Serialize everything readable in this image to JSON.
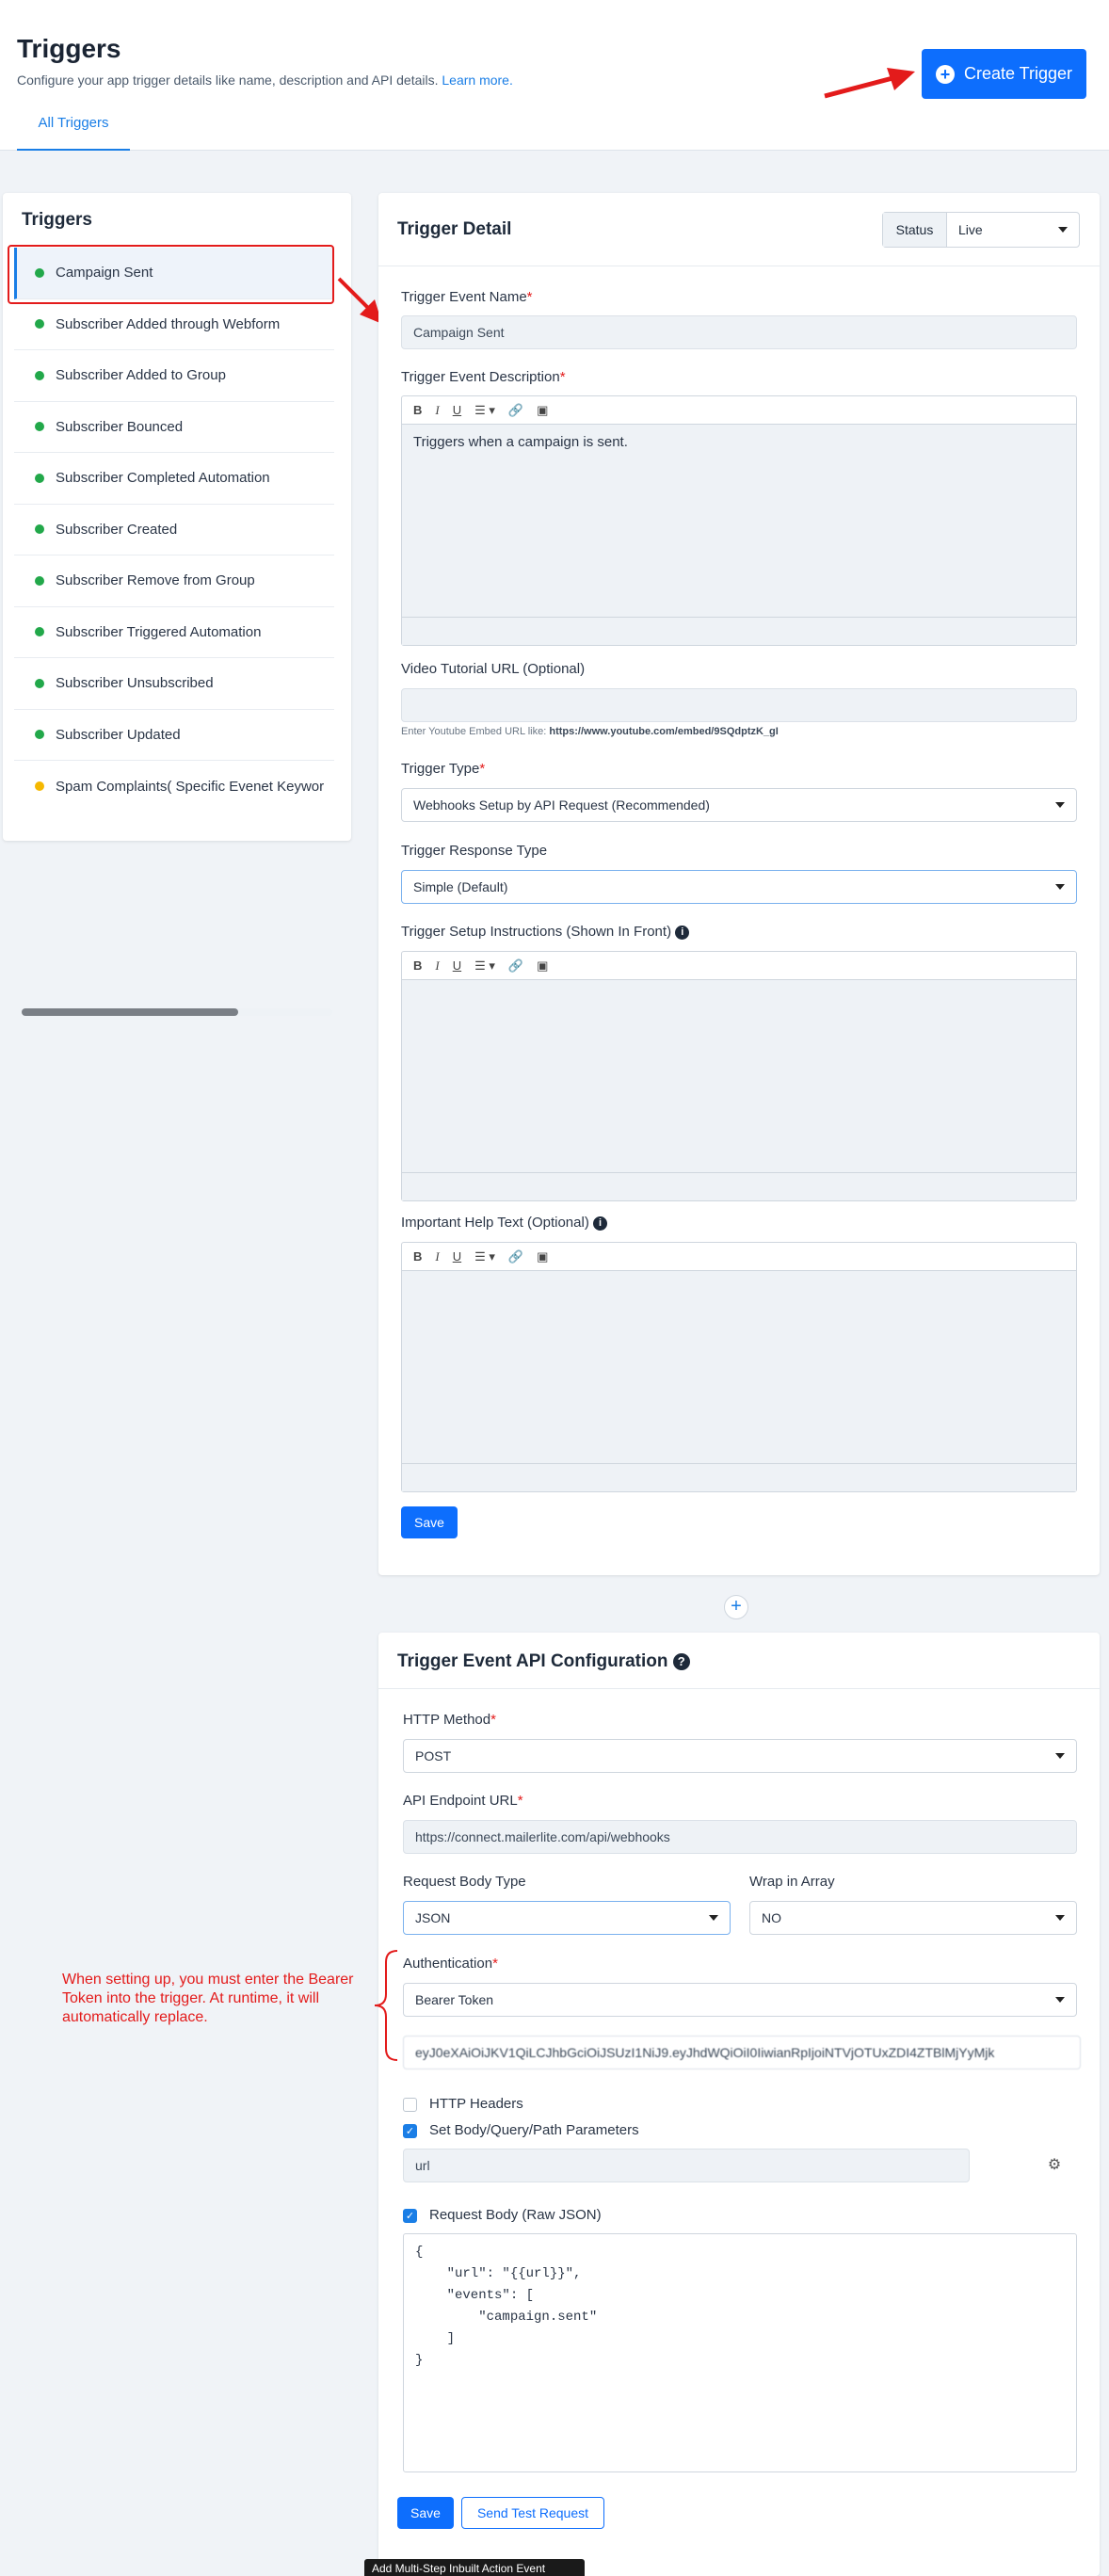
{
  "header": {
    "title": "Triggers",
    "subtitle": "Configure your app trigger details like name, description and API details.",
    "learn_more": "Learn more.",
    "tab": "All Triggers",
    "create_button": "Create Trigger"
  },
  "sidebar": {
    "title": "Triggers",
    "items": [
      {
        "label": "Campaign Sent"
      },
      {
        "label": "Subscriber Added through Webform"
      },
      {
        "label": "Subscriber Added to Group"
      },
      {
        "label": "Subscriber Bounced"
      },
      {
        "label": "Subscriber Completed Automation"
      },
      {
        "label": "Subscriber Created"
      },
      {
        "label": "Subscriber Remove from Group"
      },
      {
        "label": "Subscriber Triggered Automation"
      },
      {
        "label": "Subscriber Unsubscribed"
      },
      {
        "label": "Subscriber Updated"
      },
      {
        "label": "Spam Complaints( Specific Evenet Keywor"
      }
    ]
  },
  "detail": {
    "title": "Trigger Detail",
    "status_label": "Status",
    "status_value": "Live",
    "event_name_label": "Trigger Event Name",
    "event_name_value": "Campaign Sent",
    "description_label": "Trigger Event Description",
    "description_value": "Triggers when a campaign is sent.",
    "video_label": "Video Tutorial URL (Optional)",
    "video_hint": "Enter Youtube Embed URL like:",
    "video_hint_url": "https://www.youtube.com/embed/9SQdptzK_gI",
    "type_label": "Trigger Type",
    "type_value": "Webhooks Setup by API Request (Recommended)",
    "response_label": "Trigger Response Type",
    "response_value": "Simple (Default)",
    "instructions_label": "Trigger Setup Instructions (Shown In Front)",
    "help_label": "Important Help Text (Optional)",
    "save": "Save"
  },
  "api": {
    "title": "Trigger Event API Configuration",
    "method_label": "HTTP Method",
    "method_value": "POST",
    "endpoint_label": "API Endpoint URL",
    "endpoint_value": "https://connect.mailerlite.com/api/webhooks",
    "body_type_label": "Request Body Type",
    "body_type_value": "JSON",
    "wrap_label": "Wrap in Array",
    "wrap_value": "NO",
    "auth_label": "Authentication",
    "auth_value": "Bearer Token",
    "token_value": "eyJ0eXAiOiJKV1QiLCJhbGciOiJSUzI1NiJ9.eyJhdWQiOiI0IiwianRpIjoiNTVjOTUxZDI4ZTBlMjYyMjk",
    "http_headers": "HTTP Headers",
    "set_params": "Set Body/Query/Path Parameters",
    "param_value": "url",
    "raw_json_label": "Request Body (Raw JSON)",
    "json_lines": [
      "{",
      "    \"url\": \"{{url}}\",",
      "    \"events\": [",
      "        \"campaign.sent\"",
      "    ]",
      "}"
    ],
    "save": "Save",
    "send_test": "Send Test Request"
  },
  "annotation": "When setting up, you must enter the Bearer Token into the trigger. At runtime, it will automatically replace.",
  "tooltip": "Add Multi-Step Inbuilt Action Event"
}
